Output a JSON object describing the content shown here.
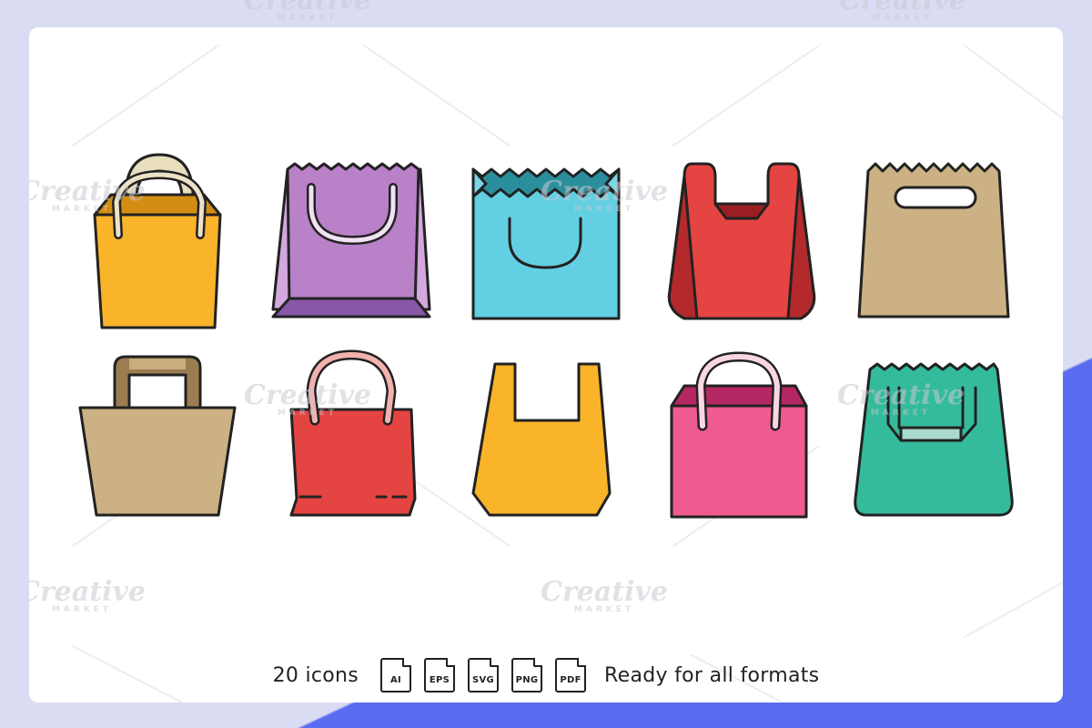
{
  "watermark": {
    "brand": "Creative",
    "sub": "MARKET"
  },
  "footer": {
    "count_text": "20 icons",
    "formats": [
      "AI",
      "EPS",
      "SVG",
      "PNG",
      "PDF"
    ],
    "tagline": "Ready for all formats"
  },
  "colors": {
    "background": "#5a6cf0",
    "card": "#ffffff",
    "outline": "#222222",
    "yellow": "#f9b42a",
    "purple": "#b981c8",
    "cyan": "#63cfe2",
    "red": "#e44442",
    "kraft": "#cbb183",
    "pink": "#ef5b91",
    "green": "#34bb9c"
  },
  "icons": [
    "shopping-bag-yellow-icon",
    "shopping-bag-purple-icon",
    "shopping-bag-cyan-icon",
    "plastic-bag-red-icon",
    "paper-bag-kraft-icon",
    "tote-bag-kraft-icon",
    "shopping-bag-red-icon",
    "plastic-bag-yellow-icon",
    "shopping-bag-pink-icon",
    "shopping-bag-green-icon"
  ]
}
